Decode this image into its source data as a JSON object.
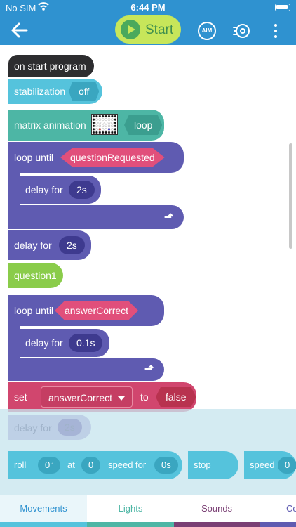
{
  "status_bar": {
    "carrier": "No SIM",
    "time": "6:44 PM"
  },
  "toolbar": {
    "start_label": "Start",
    "aim_label": "AIM"
  },
  "blocks": {
    "on_start": "on start program",
    "stabilization": {
      "label": "stabilization",
      "value": "off"
    },
    "matrix_animation": {
      "label": "matrix animation",
      "value": "loop"
    },
    "loop_until_1": {
      "label": "loop until",
      "condition": "questionRequested"
    },
    "delay_1": {
      "label": "delay for",
      "value": "2s"
    },
    "delay_2": {
      "label": "delay for",
      "value": "2s"
    },
    "question1": "question1",
    "loop_until_2": {
      "label": "loop until",
      "condition": "answerCorrect"
    },
    "delay_3": {
      "label": "delay for",
      "value": "0.1s"
    },
    "set": {
      "label": "set",
      "variable": "answerCorrect",
      "to": "to",
      "value": "false"
    }
  },
  "palette": {
    "faded_delay": {
      "label": "delay for",
      "value": "2s"
    },
    "roll": {
      "label": "roll",
      "heading": "0°",
      "at": "at",
      "speed": "0",
      "speed_for": "speed for",
      "duration": "0s"
    },
    "stop": "stop",
    "speed": {
      "label": "speed",
      "value": "0"
    }
  },
  "tabs": [
    {
      "label": "Movements",
      "color": "#55c3dc",
      "text_color": "#2f92d0",
      "active": true
    },
    {
      "label": "Lights",
      "color": "#4db6a5",
      "text_color": "#4db6a5",
      "active": false
    },
    {
      "label": "Sounds",
      "color": "#7a3f74",
      "text_color": "#7a3f74",
      "active": false
    },
    {
      "label": "Co",
      "color": "#5f5bb1",
      "text_color": "#5f5bb1",
      "active": false
    }
  ],
  "colors": {
    "toolbar": "#2f92d0",
    "start": "#c7e65a",
    "movement": "#55c3dc",
    "control": "#5f5bb1",
    "variable": "#d1466e",
    "lights": "#4db6a5",
    "event": "#8acc4a"
  },
  "icons": [
    "back-arrow-icon",
    "play-icon",
    "aim-icon",
    "drive-icon",
    "more-vertical-icon",
    "loop-arrow-icon",
    "caret-down-icon",
    "wifi-icon",
    "battery-icon"
  ]
}
